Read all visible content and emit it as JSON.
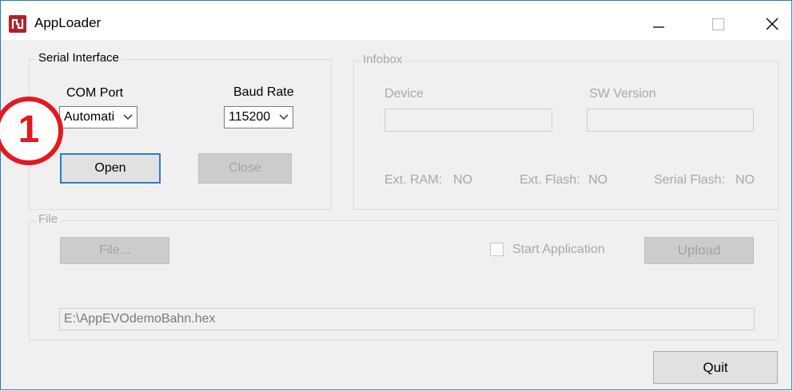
{
  "window": {
    "title": "AppLoader",
    "controls": {
      "minimize": "minimize-icon",
      "maximize": "maximize-icon",
      "close": "close-icon"
    },
    "accent": "#1f78c8"
  },
  "serial": {
    "group_label": "Serial Interface",
    "com_port_label": "COM Port",
    "com_port_value": "Automati",
    "baud_rate_label": "Baud Rate",
    "baud_rate_value": "115200",
    "open_label": "Open",
    "close_label": "Close"
  },
  "infobox": {
    "group_label": "Infobox",
    "device_label": "Device",
    "device_value": "",
    "sw_version_label": "SW Version",
    "sw_version_value": "",
    "ext_ram_label": "Ext. RAM:",
    "ext_ram_value": "NO",
    "ext_flash_label": "Ext. Flash:",
    "ext_flash_value": "NO",
    "serial_flash_label": "Serial Flash:",
    "serial_flash_value": "NO"
  },
  "file": {
    "group_label": "File",
    "file_button_label": "File...",
    "start_application_label": "Start Application",
    "start_application_checked": false,
    "upload_label": "Upload",
    "path_value": "E:\\AppEVOdemoBahn.hex"
  },
  "quit_label": "Quit",
  "annotation": {
    "marker_number": "1",
    "color": "#e3191f"
  }
}
